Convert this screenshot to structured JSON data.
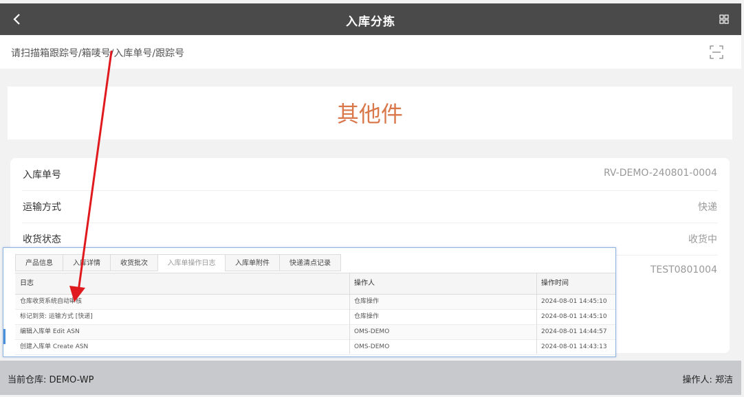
{
  "header": {
    "title": "入库分拣"
  },
  "scan": {
    "placeholder": "请扫描箱跟踪号/箱唛号/入库单号/跟踪号"
  },
  "category": {
    "label": "其他件"
  },
  "info": {
    "rows": [
      {
        "label": "入库单号",
        "value": "RV-DEMO-240801-0004"
      },
      {
        "label": "运输方式",
        "value": "快递"
      },
      {
        "label": "收货状态",
        "value": "收货中"
      },
      {
        "label": "",
        "value": "TEST0801004"
      }
    ]
  },
  "footer": {
    "warehouse": "当前仓库: DEMO-WP",
    "operator": "操作人: 郑洁"
  },
  "log_panel": {
    "tabs": [
      "产品信息",
      "入库详情",
      "收货批次",
      "入库单操作日志",
      "入库单附件",
      "快递清点记录"
    ],
    "active_tab": 3,
    "columns": [
      "日志",
      "操作人",
      "操作时间"
    ],
    "rows": [
      {
        "log": "仓库收货系统自动审核",
        "operator": "仓库操作",
        "time": "2024-08-01 14:45:10"
      },
      {
        "log": "标记到货: 运输方式 [快递]",
        "operator": "仓库操作",
        "time": "2024-08-01 14:45:10"
      },
      {
        "log": "编辑入库单 Edit ASN",
        "operator": "OMS-DEMO",
        "time": "2024-08-01 14:44:57"
      },
      {
        "log": "创建入库单 Create ASN",
        "operator": "OMS-DEMO",
        "time": "2024-08-01 14:43:13"
      }
    ]
  },
  "colors": {
    "accent": "#d9784a",
    "annotation_arrow": "#e0191e",
    "topbar": "#4a4a4a"
  },
  "icons": {
    "back": "chevron-left-icon",
    "menu": "grid-icon",
    "scan": "scan-icon"
  }
}
